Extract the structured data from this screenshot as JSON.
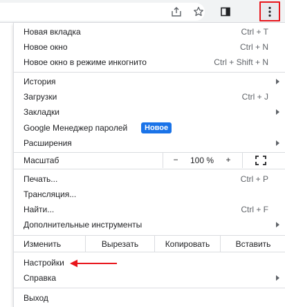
{
  "colors": {
    "highlight": "#e8151b",
    "badge": "#1a73e8",
    "arrow": "#e8151b"
  },
  "toolbar": {
    "icons": [
      "share-icon",
      "star-icon",
      "side-panel-icon",
      "kebab-menu-icon"
    ]
  },
  "menu": {
    "new_tab": {
      "label": "Новая вкладка",
      "shortcut": "Ctrl + T"
    },
    "new_window": {
      "label": "Новое окно",
      "shortcut": "Ctrl + N"
    },
    "incognito": {
      "label": "Новое окно в режиме инкогнито",
      "shortcut": "Ctrl + Shift + N"
    },
    "history": {
      "label": "История"
    },
    "downloads": {
      "label": "Загрузки",
      "shortcut": "Ctrl + J"
    },
    "bookmarks": {
      "label": "Закладки"
    },
    "password_manager": {
      "label": "Google Менеджер паролей",
      "badge": "Новое"
    },
    "extensions": {
      "label": "Расширения"
    },
    "zoom": {
      "label": "Масштаб",
      "minus": "−",
      "value": "100 %",
      "plus": "+"
    },
    "print": {
      "label": "Печать...",
      "shortcut": "Ctrl + P"
    },
    "cast": {
      "label": "Трансляция..."
    },
    "find": {
      "label": "Найти...",
      "shortcut": "Ctrl + F"
    },
    "more_tools": {
      "label": "Дополнительные инструменты"
    },
    "edit": {
      "label": "Изменить",
      "cut": "Вырезать",
      "copy": "Копировать",
      "paste": "Вставить"
    },
    "settings": {
      "label": "Настройки"
    },
    "help": {
      "label": "Справка"
    },
    "exit": {
      "label": "Выход"
    }
  }
}
